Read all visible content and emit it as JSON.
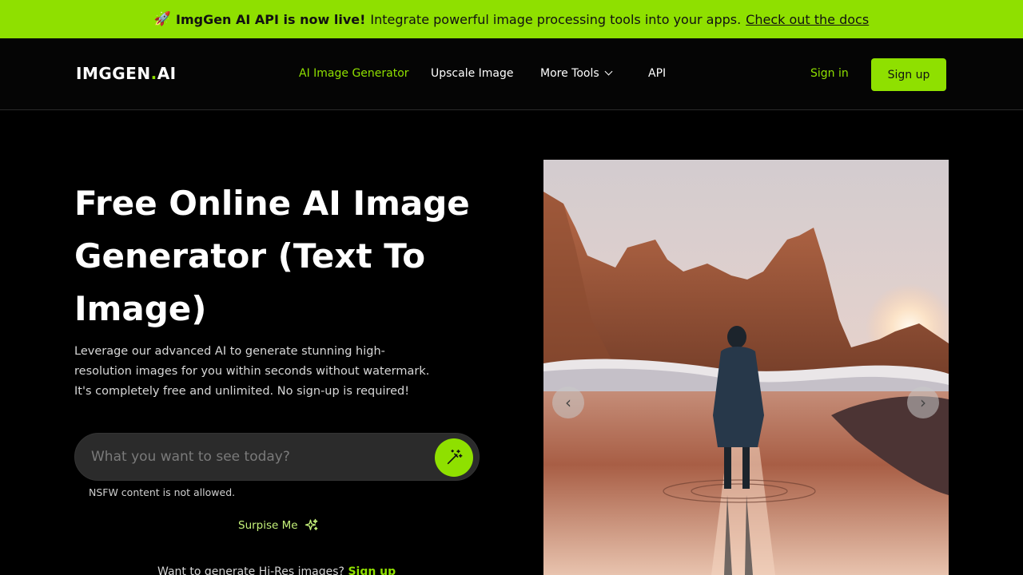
{
  "banner": {
    "icon": "rocket-icon",
    "headline": "ImgGen AI API is now live!",
    "text": "Integrate powerful image processing tools into your apps.",
    "link": "Check out the docs"
  },
  "header": {
    "logo_main": "IMGGEN",
    "logo_dot": ".",
    "logo_suffix": "AI",
    "nav": [
      {
        "label": "AI Image Generator",
        "active": true
      },
      {
        "label": "Upscale Image"
      },
      {
        "label": "More Tools"
      },
      {
        "label": "API"
      }
    ],
    "signin": "Sign in",
    "signup": "Sign up"
  },
  "hero": {
    "title": "Free Online AI Image Generator (Text To Image)",
    "description_lines": [
      "Leverage our advanced AI to generate stunning high-",
      "resolution images for you within seconds without watermark.",
      "It's completely free and unlimited. No sign-up is required!"
    ],
    "prompt_placeholder": "What you want to see today?",
    "nsfw_note": "NSFW content is not allowed.",
    "surprise": "Surpise Me",
    "hires_text": "Want to generate Hi-Res images?",
    "hires_link": "Sign up"
  },
  "colors": {
    "accent": "#8fe000",
    "background": "#000000"
  }
}
